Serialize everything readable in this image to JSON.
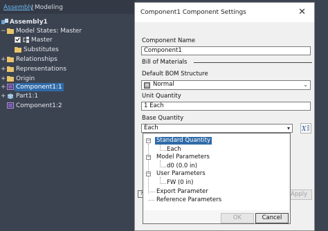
{
  "browser": {
    "tabs": {
      "assembly": "Assembly",
      "separator": "|",
      "modeling": "Modeling"
    },
    "tree": {
      "root": "Assembly1",
      "model_states": "Model States: Master",
      "master": "Master",
      "substitutes": "Substitutes",
      "relationships": "Relationships",
      "representations": "Representations",
      "origin": "Origin",
      "component1_1": "Component1:1",
      "part1_1": "Part1:1",
      "component1_2": "Component1:2"
    }
  },
  "dialog": {
    "title": "Component1 Component Settings",
    "close": "✕",
    "component_name_label": "Component Name",
    "component_name_value": "Component1",
    "bom_section": "Bill of Materials",
    "default_bom_label": "Default BOM Structure",
    "default_bom_value": "Normal",
    "unit_quantity_label": "Unit Quantity",
    "unit_quantity_value": "1 Each",
    "base_quantity_label": "Base Quantity",
    "base_quantity_value": "Each",
    "apply_label": "Apply"
  },
  "popup": {
    "items": {
      "standard_quantity": "Standard Quantity",
      "each": "Each",
      "model_parameters": "Model Parameters",
      "d0": "d0 (0.0 in)",
      "user_parameters": "User Parameters",
      "fw": "FW (0 in)",
      "export_parameter": "Export Parameter",
      "reference_parameters": "Reference Parameters"
    },
    "ok_label": "OK",
    "cancel_label": "Cancel"
  },
  "colors": {
    "selection": "#2f6aa8",
    "browser_bg": "#3b4351",
    "tab_active": "#6fb8f2"
  }
}
